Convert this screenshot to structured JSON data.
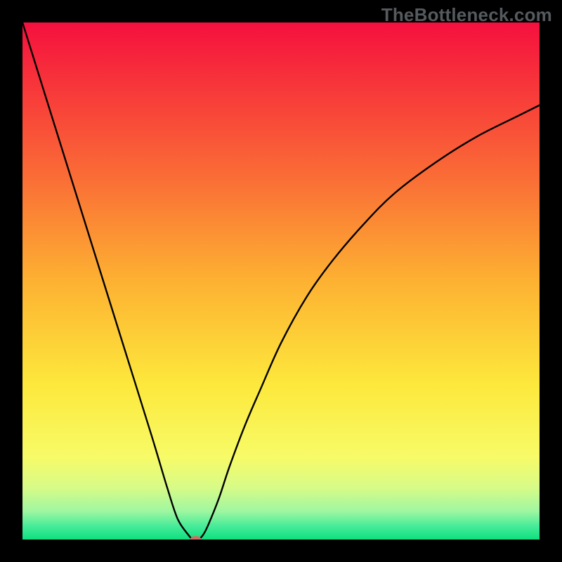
{
  "watermark": "TheBottleneck.com",
  "chart_data": {
    "type": "line",
    "title": "",
    "xlabel": "",
    "ylabel": "",
    "xlim": [
      0,
      100
    ],
    "ylim": [
      0,
      100
    ],
    "grid": false,
    "legend": false,
    "annotations": [],
    "background_gradient": {
      "stops": [
        {
          "pos": 0.0,
          "color": "#f5103e"
        },
        {
          "pos": 0.12,
          "color": "#f7353a"
        },
        {
          "pos": 0.3,
          "color": "#fa6d36"
        },
        {
          "pos": 0.5,
          "color": "#fdb132"
        },
        {
          "pos": 0.7,
          "color": "#fde83c"
        },
        {
          "pos": 0.84,
          "color": "#f7fb67"
        },
        {
          "pos": 0.9,
          "color": "#d7fb88"
        },
        {
          "pos": 0.945,
          "color": "#9ff7a0"
        },
        {
          "pos": 0.975,
          "color": "#44eb98"
        },
        {
          "pos": 1.0,
          "color": "#0ee07f"
        }
      ]
    },
    "series": [
      {
        "name": "bottleneck-curve",
        "color": "#000000",
        "x": [
          0,
          5,
          10,
          15,
          20,
          25,
          28,
          30,
          32,
          33,
          34,
          35,
          36,
          38,
          40,
          43,
          46,
          50,
          55,
          60,
          66,
          72,
          80,
          88,
          96,
          100
        ],
        "y": [
          100,
          84,
          68,
          52,
          36,
          20,
          10,
          4,
          1,
          0,
          0,
          1,
          3,
          8,
          14,
          22,
          29,
          38,
          47,
          54,
          61,
          67,
          73,
          78,
          82,
          84
        ]
      }
    ],
    "marker": {
      "name": "min-marker",
      "x": 33.5,
      "y": 0,
      "color": "#cf6e66",
      "rx": 8,
      "ry": 5
    }
  }
}
